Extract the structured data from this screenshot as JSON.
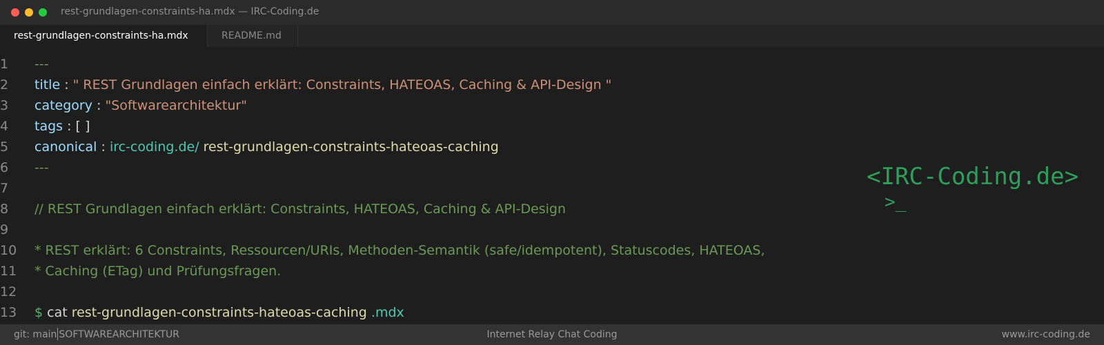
{
  "window": {
    "title": "rest-grundlagen-constraints-ha.mdx — IRC-Coding.de"
  },
  "tabs": [
    {
      "label": "rest-grundlagen-constraints-ha.mdx",
      "active": true
    },
    {
      "label": "README.md",
      "active": false
    }
  ],
  "editor": {
    "lines": [
      {
        "n": "1",
        "dashes": "---"
      },
      {
        "n": "2",
        "key": "title",
        "sep": " : ",
        "value": "\" REST Grundlagen einfach erklärt: Constraints, HATEOAS, Caching & API-Design \""
      },
      {
        "n": "3",
        "key": "category",
        "sep": " : ",
        "value": "\"Softwarearchitektur\""
      },
      {
        "n": "4",
        "key": "tags",
        "sep": " : ",
        "value": "[ ]"
      },
      {
        "n": "5",
        "key": "canonical",
        "sep": " : ",
        "domain": "irc-coding.de/",
        "slug": " rest-grundlagen-constraints-hateoas-caching"
      },
      {
        "n": "6",
        "dashes": "---"
      },
      {
        "n": "7"
      },
      {
        "n": "8",
        "comment": "// REST Grundlagen einfach erklärt: Constraints, HATEOAS, Caching & API-Design"
      },
      {
        "n": "9"
      },
      {
        "n": "10",
        "comment": "* REST erklärt: 6 Constraints, Ressourcen/URIs, Methoden-Semantik (safe/idempotent), Statuscodes, HATEOAS,"
      },
      {
        "n": "11",
        "comment": "* Caching (ETag) und Prüfungsfragen."
      },
      {
        "n": "12"
      },
      {
        "n": "13",
        "prompt": "$",
        "cmd": " cat",
        "file": " rest-grundlagen-constraints-hateoas-caching",
        "ext": " .mdx"
      }
    ]
  },
  "logo": {
    "text": "<IRC-Coding.de>",
    "prompt": ">_"
  },
  "statusbar": {
    "branch": "git: main",
    "category": "SOFTWAREARCHITEKTUR",
    "center": "Internet Relay Chat Coding",
    "right": "www.irc-coding.de"
  },
  "colors": {
    "background": "#1e1e1e",
    "key": "#9cdcfe",
    "string": "#ce9178",
    "comment": "#6a9955",
    "link": "#4ec9b0",
    "identifier": "#dcdcaa",
    "logo": "#2e9e5a"
  }
}
